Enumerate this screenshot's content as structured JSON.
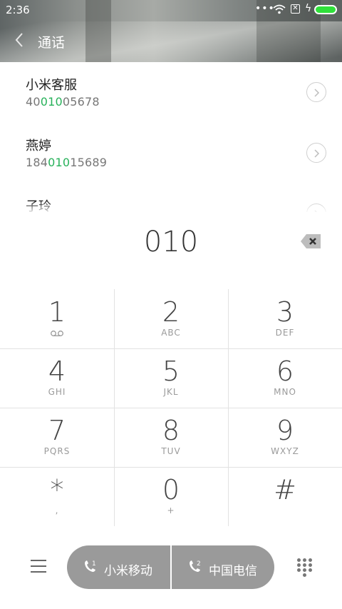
{
  "status": {
    "time": "2:36",
    "dots": "•••"
  },
  "appbar": {
    "title": "通话"
  },
  "contacts": [
    {
      "name": "小米客服",
      "num_pre": "40",
      "num_match": "010",
      "num_post": "05678"
    },
    {
      "name": "燕婷",
      "num_pre": "184",
      "num_match": "010",
      "num_post": "15689"
    },
    {
      "name": "子玲"
    }
  ],
  "dial": {
    "digits": "010"
  },
  "keys": [
    {
      "digit": "1",
      "letters": ""
    },
    {
      "digit": "2",
      "letters": "ABC"
    },
    {
      "digit": "3",
      "letters": "DEF"
    },
    {
      "digit": "4",
      "letters": "GHI"
    },
    {
      "digit": "5",
      "letters": "JKL"
    },
    {
      "digit": "6",
      "letters": "MNO"
    },
    {
      "digit": "7",
      "letters": "PQRS"
    },
    {
      "digit": "8",
      "letters": "TUV"
    },
    {
      "digit": "9",
      "letters": "WXYZ"
    },
    {
      "digit": "*",
      "letters": ","
    },
    {
      "digit": "0",
      "letters": "+"
    },
    {
      "digit": "#",
      "letters": ""
    }
  ],
  "call_buttons": [
    {
      "label": "小米移动",
      "sim": "1"
    },
    {
      "label": "中国电信",
      "sim": "2"
    }
  ],
  "colors": {
    "match_highlight": "#27b15a",
    "battery": "#2fe03a",
    "call_group_bg": "#9a9a9a"
  }
}
